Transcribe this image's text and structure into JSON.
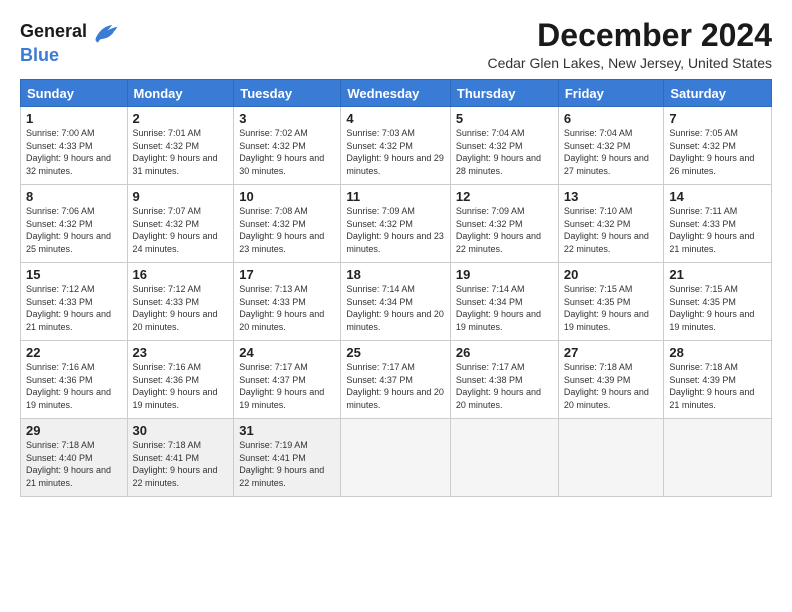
{
  "logo": {
    "line1": "General",
    "line2": "Blue"
  },
  "title": "December 2024",
  "location": "Cedar Glen Lakes, New Jersey, United States",
  "days_header": [
    "Sunday",
    "Monday",
    "Tuesday",
    "Wednesday",
    "Thursday",
    "Friday",
    "Saturday"
  ],
  "weeks": [
    [
      {
        "num": "1",
        "rise": "7:00 AM",
        "set": "4:33 PM",
        "daylight": "9 hours and 32 minutes."
      },
      {
        "num": "2",
        "rise": "7:01 AM",
        "set": "4:32 PM",
        "daylight": "9 hours and 31 minutes."
      },
      {
        "num": "3",
        "rise": "7:02 AM",
        "set": "4:32 PM",
        "daylight": "9 hours and 30 minutes."
      },
      {
        "num": "4",
        "rise": "7:03 AM",
        "set": "4:32 PM",
        "daylight": "9 hours and 29 minutes."
      },
      {
        "num": "5",
        "rise": "7:04 AM",
        "set": "4:32 PM",
        "daylight": "9 hours and 28 minutes."
      },
      {
        "num": "6",
        "rise": "7:04 AM",
        "set": "4:32 PM",
        "daylight": "9 hours and 27 minutes."
      },
      {
        "num": "7",
        "rise": "7:05 AM",
        "set": "4:32 PM",
        "daylight": "9 hours and 26 minutes."
      }
    ],
    [
      {
        "num": "8",
        "rise": "7:06 AM",
        "set": "4:32 PM",
        "daylight": "9 hours and 25 minutes."
      },
      {
        "num": "9",
        "rise": "7:07 AM",
        "set": "4:32 PM",
        "daylight": "9 hours and 24 minutes."
      },
      {
        "num": "10",
        "rise": "7:08 AM",
        "set": "4:32 PM",
        "daylight": "9 hours and 23 minutes."
      },
      {
        "num": "11",
        "rise": "7:09 AM",
        "set": "4:32 PM",
        "daylight": "9 hours and 23 minutes."
      },
      {
        "num": "12",
        "rise": "7:09 AM",
        "set": "4:32 PM",
        "daylight": "9 hours and 22 minutes."
      },
      {
        "num": "13",
        "rise": "7:10 AM",
        "set": "4:32 PM",
        "daylight": "9 hours and 22 minutes."
      },
      {
        "num": "14",
        "rise": "7:11 AM",
        "set": "4:33 PM",
        "daylight": "9 hours and 21 minutes."
      }
    ],
    [
      {
        "num": "15",
        "rise": "7:12 AM",
        "set": "4:33 PM",
        "daylight": "9 hours and 21 minutes."
      },
      {
        "num": "16",
        "rise": "7:12 AM",
        "set": "4:33 PM",
        "daylight": "9 hours and 20 minutes."
      },
      {
        "num": "17",
        "rise": "7:13 AM",
        "set": "4:33 PM",
        "daylight": "9 hours and 20 minutes."
      },
      {
        "num": "18",
        "rise": "7:14 AM",
        "set": "4:34 PM",
        "daylight": "9 hours and 20 minutes."
      },
      {
        "num": "19",
        "rise": "7:14 AM",
        "set": "4:34 PM",
        "daylight": "9 hours and 19 minutes."
      },
      {
        "num": "20",
        "rise": "7:15 AM",
        "set": "4:35 PM",
        "daylight": "9 hours and 19 minutes."
      },
      {
        "num": "21",
        "rise": "7:15 AM",
        "set": "4:35 PM",
        "daylight": "9 hours and 19 minutes."
      }
    ],
    [
      {
        "num": "22",
        "rise": "7:16 AM",
        "set": "4:36 PM",
        "daylight": "9 hours and 19 minutes."
      },
      {
        "num": "23",
        "rise": "7:16 AM",
        "set": "4:36 PM",
        "daylight": "9 hours and 19 minutes."
      },
      {
        "num": "24",
        "rise": "7:17 AM",
        "set": "4:37 PM",
        "daylight": "9 hours and 19 minutes."
      },
      {
        "num": "25",
        "rise": "7:17 AM",
        "set": "4:37 PM",
        "daylight": "9 hours and 20 minutes."
      },
      {
        "num": "26",
        "rise": "7:17 AM",
        "set": "4:38 PM",
        "daylight": "9 hours and 20 minutes."
      },
      {
        "num": "27",
        "rise": "7:18 AM",
        "set": "4:39 PM",
        "daylight": "9 hours and 20 minutes."
      },
      {
        "num": "28",
        "rise": "7:18 AM",
        "set": "4:39 PM",
        "daylight": "9 hours and 21 minutes."
      }
    ],
    [
      {
        "num": "29",
        "rise": "7:18 AM",
        "set": "4:40 PM",
        "daylight": "9 hours and 21 minutes."
      },
      {
        "num": "30",
        "rise": "7:18 AM",
        "set": "4:41 PM",
        "daylight": "9 hours and 22 minutes."
      },
      {
        "num": "31",
        "rise": "7:19 AM",
        "set": "4:41 PM",
        "daylight": "9 hours and 22 minutes."
      },
      null,
      null,
      null,
      null
    ]
  ]
}
